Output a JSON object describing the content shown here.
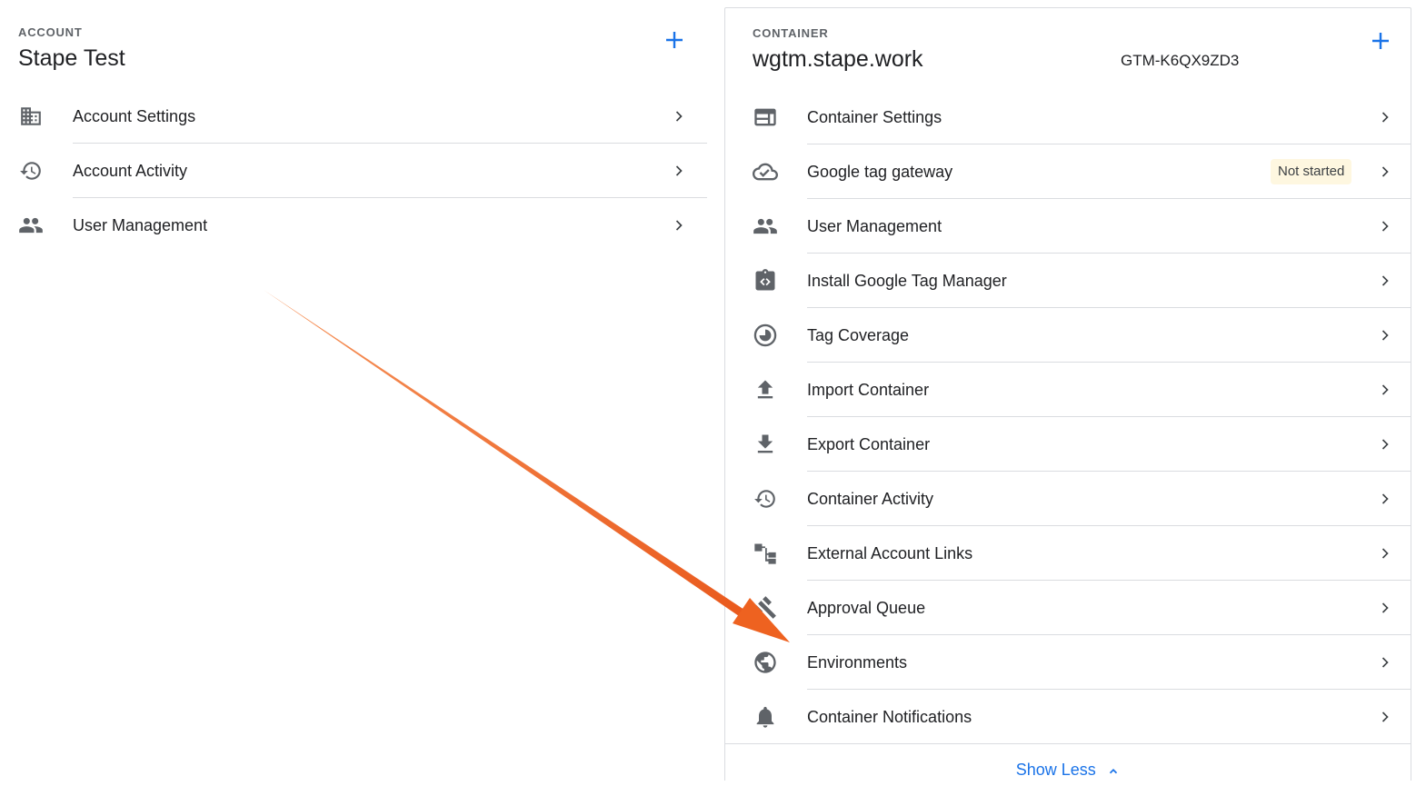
{
  "account": {
    "eyebrow": "ACCOUNT",
    "title": "Stape Test",
    "items": [
      {
        "label": "Account Settings",
        "icon": "building-icon"
      },
      {
        "label": "Account Activity",
        "icon": "history-icon"
      },
      {
        "label": "User Management",
        "icon": "people-icon"
      }
    ]
  },
  "container": {
    "eyebrow": "CONTAINER",
    "title": "wgtm.stape.work",
    "gtm_id": "GTM-K6QX9ZD3",
    "items": [
      {
        "label": "Container Settings",
        "icon": "web-window-icon"
      },
      {
        "label": "Google tag gateway",
        "icon": "cloud-check-icon",
        "badge": "Not started"
      },
      {
        "label": "User Management",
        "icon": "people-icon"
      },
      {
        "label": "Install Google Tag Manager",
        "icon": "code-clipboard-icon"
      },
      {
        "label": "Tag Coverage",
        "icon": "pie-clock-icon"
      },
      {
        "label": "Import Container",
        "icon": "upload-icon"
      },
      {
        "label": "Export Container",
        "icon": "download-icon"
      },
      {
        "label": "Container Activity",
        "icon": "history-icon"
      },
      {
        "label": "External Account Links",
        "icon": "account-tree-icon"
      },
      {
        "label": "Approval Queue",
        "icon": "gavel-icon"
      },
      {
        "label": "Environments",
        "icon": "globe-icon"
      },
      {
        "label": "Container Notifications",
        "icon": "bell-icon"
      }
    ],
    "show_less": "Show Less"
  },
  "colors": {
    "accent": "#1a73e8",
    "icon": "#5f6368",
    "arrow": "#f06a25",
    "badge_bg": "#fef7e0"
  }
}
